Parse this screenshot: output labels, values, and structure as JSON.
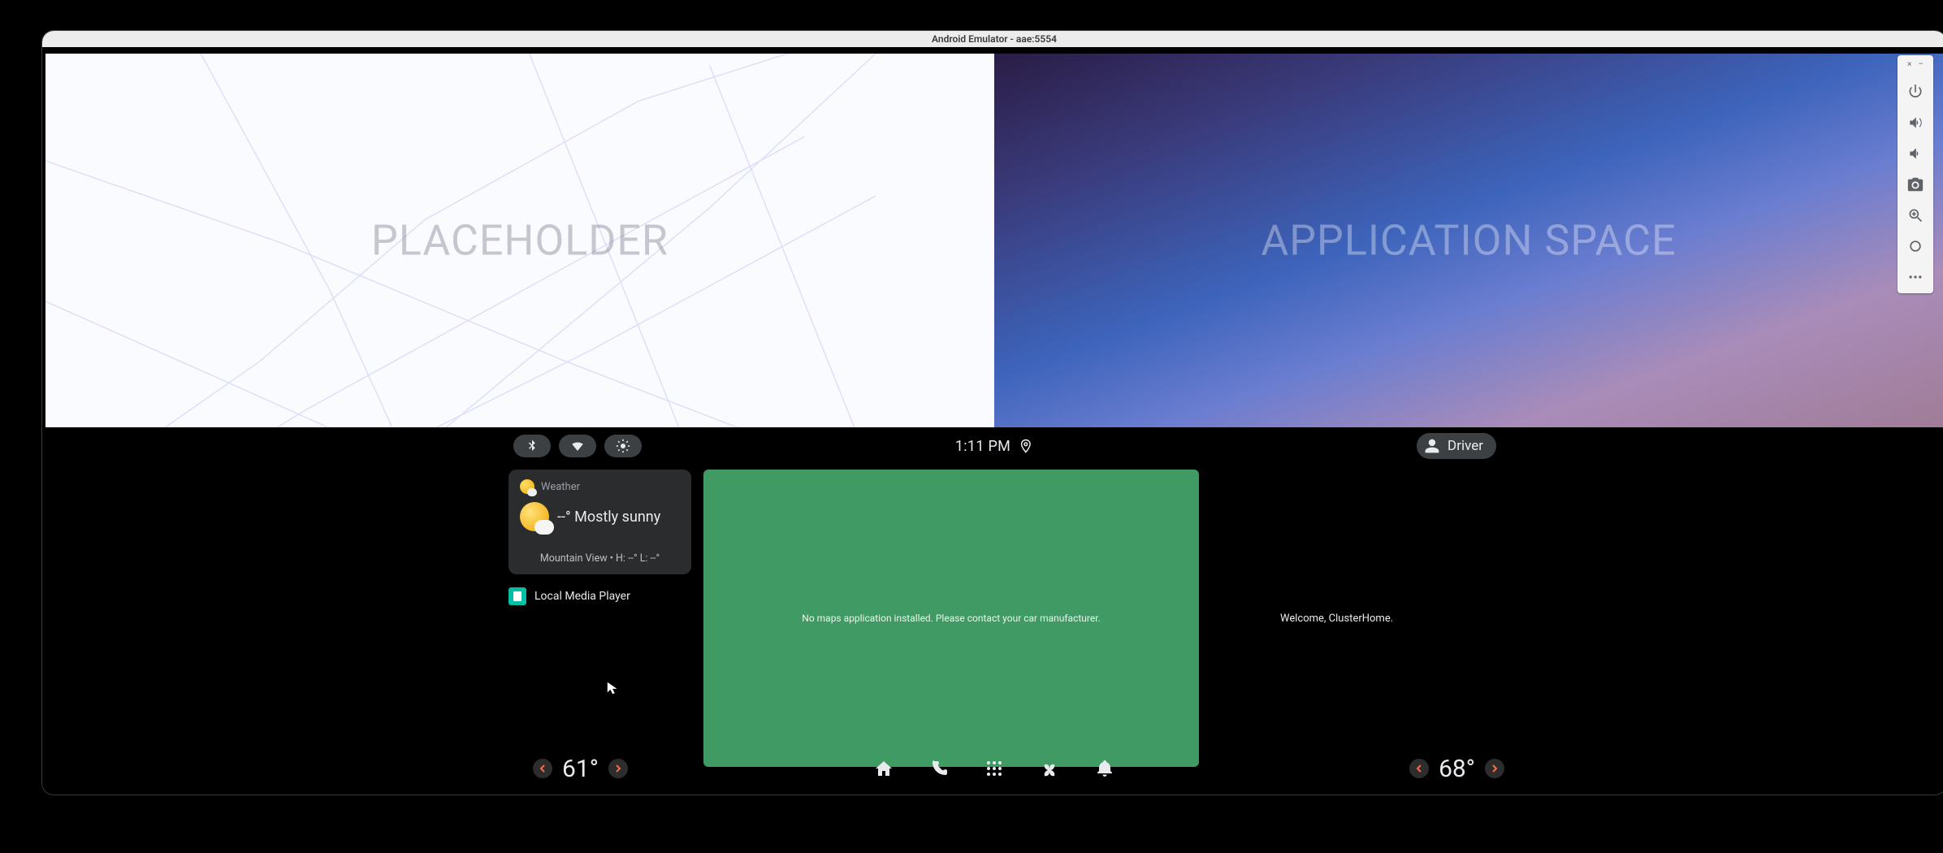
{
  "window": {
    "title": "Android Emulator - aae:5554"
  },
  "side_toolbar": {
    "close": "×",
    "minimize": "–",
    "items": [
      "power",
      "volume-up",
      "volume-down",
      "camera",
      "zoom",
      "back",
      "more"
    ]
  },
  "upper": {
    "left_label": "PLACEHOLDER",
    "right_label": "APPLICATION SPACE"
  },
  "statusbar": {
    "toggles": [
      "bluetooth",
      "wifi",
      "brightness"
    ],
    "time": "1:11 PM",
    "profile": "Driver"
  },
  "weather": {
    "title": "Weather",
    "headline": "--° Mostly sunny",
    "subline": "Mountain View • H: --° L: --°"
  },
  "media": {
    "label": "Local Media Player"
  },
  "map_tile": {
    "message": "No maps application installed. Please contact your car manufacturer."
  },
  "cluster": {
    "welcome": "Welcome, ClusterHome."
  },
  "hvac": {
    "left_temp": "61°",
    "right_temp": "68°"
  },
  "nav": {
    "items": [
      "home",
      "phone",
      "apps",
      "fan",
      "notifications"
    ]
  }
}
